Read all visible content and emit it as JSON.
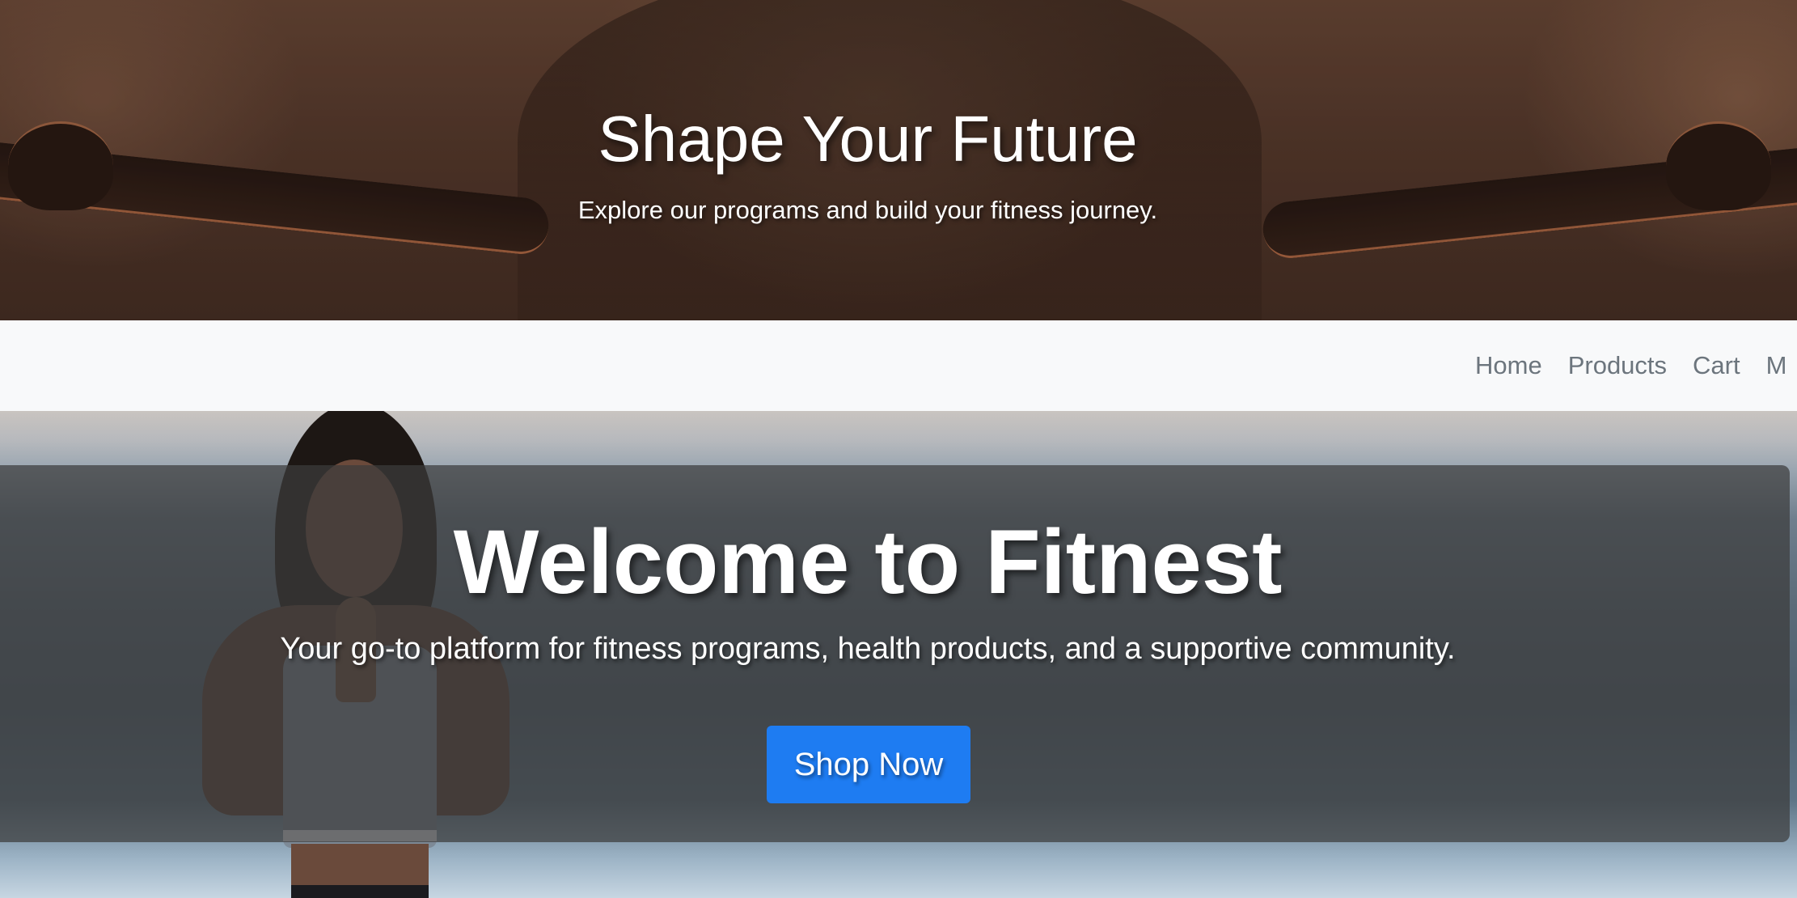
{
  "top_hero": {
    "title": "Shape Your Future",
    "subtitle": "Explore our programs and build your fitness journey."
  },
  "navbar": {
    "links": [
      "Home",
      "Products",
      "Cart",
      "M"
    ]
  },
  "main_hero": {
    "title": "Welcome to Fitnest",
    "lead": "Your go-to platform for fitness programs, health products, and a supportive community.",
    "button_label": "Shop Now"
  },
  "colors": {
    "button_primary": "#1e7cf2",
    "navbar_bg": "#f8f9fa",
    "nav_link": "#6c757d",
    "overlay": "rgba(60,60,60,0.72)"
  }
}
